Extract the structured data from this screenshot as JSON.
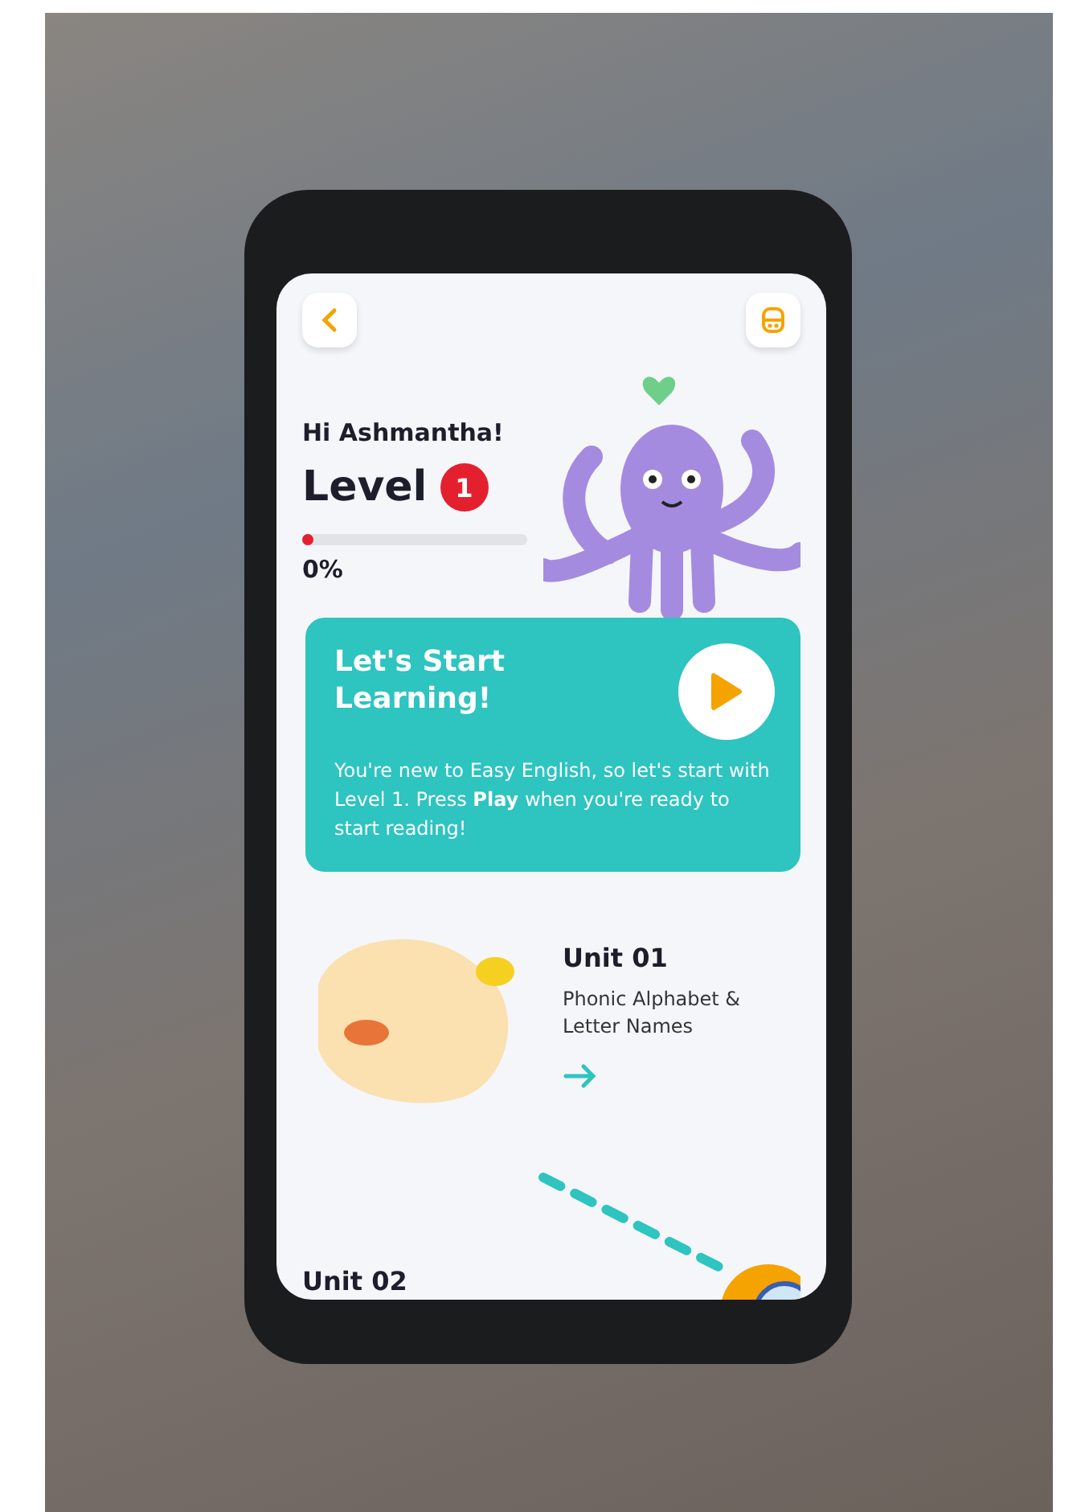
{
  "header": {
    "greeting": "Hi Ashmantha!",
    "level_label": "Level",
    "level_badge": "1"
  },
  "progress": {
    "level": 0,
    "reading": "0%"
  },
  "start_card": {
    "title": "Let's Start Learning!",
    "body": "You're new to Easy English, so let's start with Level 1. Press **Play** when you're ready to start reading!"
  },
  "units": [
    {
      "title": "Unit 01",
      "subtitle": "Phonic Alphabet & Letter Names"
    },
    {
      "title": "Unit 02"
    }
  ]
}
